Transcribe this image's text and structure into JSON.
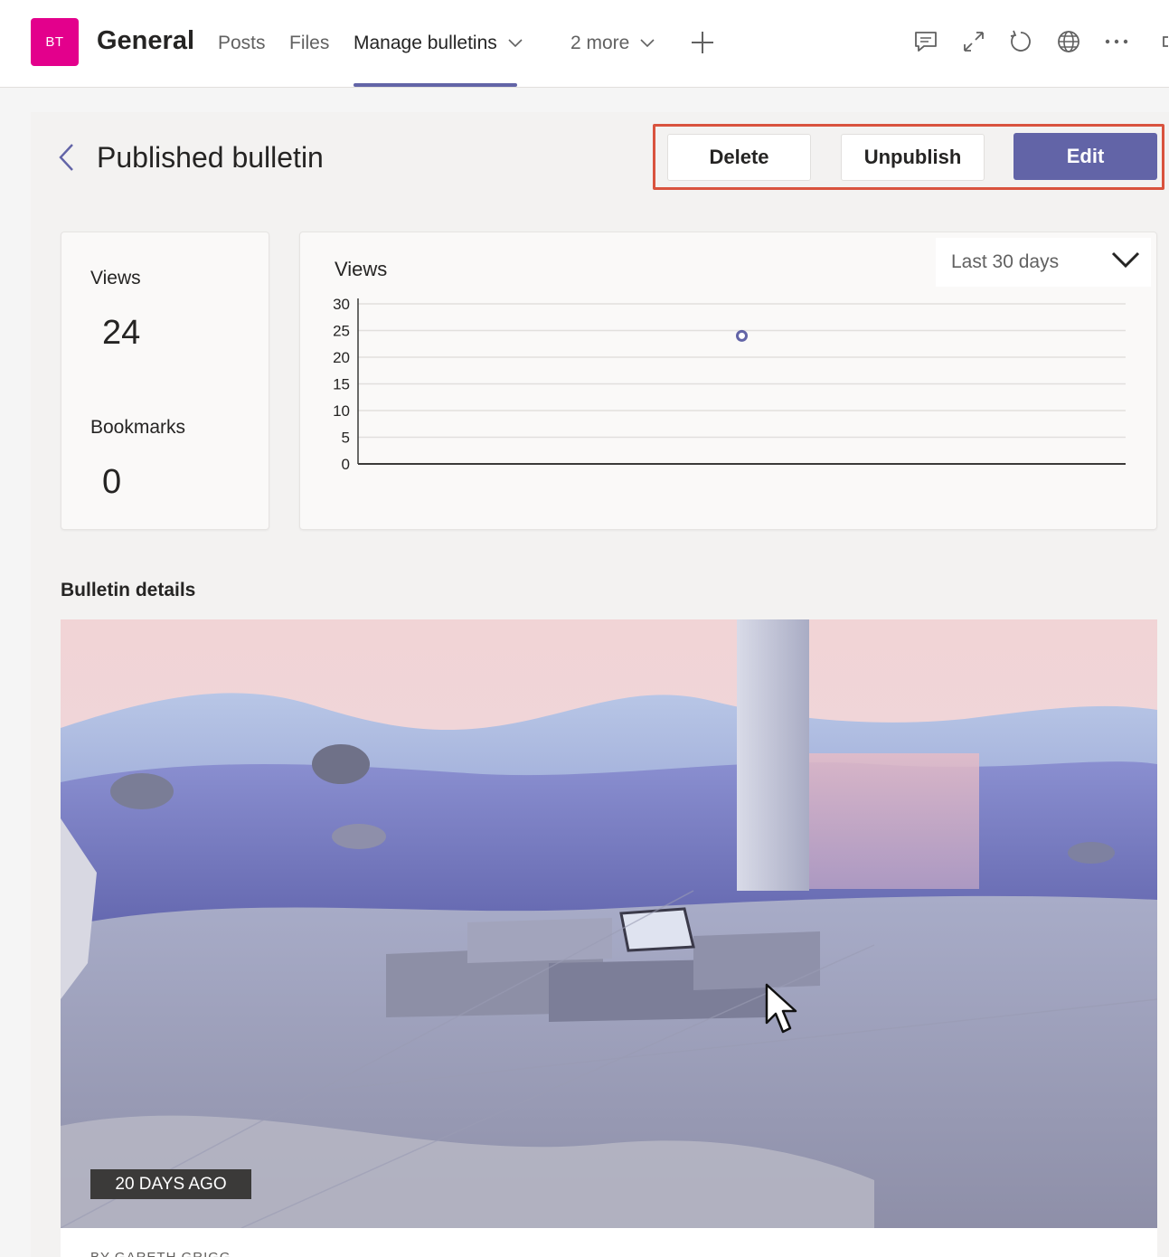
{
  "header": {
    "avatar_initials": "BT",
    "avatar_color": "#e3008c",
    "channel": "General",
    "tabs": [
      {
        "label": "Posts"
      },
      {
        "label": "Files"
      },
      {
        "label": "Manage bulletins"
      },
      {
        "label": "2 more"
      }
    ],
    "active_tab": "Manage bulletins",
    "icons": [
      "plus-icon",
      "chat-icon",
      "expand-icon",
      "refresh-icon",
      "globe-icon",
      "more-icon"
    ]
  },
  "page": {
    "title": "Published bulletin",
    "actions": {
      "delete": "Delete",
      "unpublish": "Unpublish",
      "edit": "Edit"
    },
    "accent_color": "#6264a7",
    "highlight_color": "#d9533e"
  },
  "stats": {
    "views_label": "Views",
    "views_value": "24",
    "bookmarks_label": "Bookmarks",
    "bookmarks_value": "0"
  },
  "chart": {
    "range_selected": "Last 30 days"
  },
  "chart_data": {
    "type": "scatter",
    "title": "Views",
    "xlabel": "",
    "ylabel": "",
    "ylim": [
      0,
      30
    ],
    "yticks": [
      "30",
      "25",
      "20",
      "15",
      "10",
      "5",
      "0"
    ],
    "grid": true,
    "series": [
      {
        "values": [
          {
            "x": 1,
            "y": 24
          }
        ]
      }
    ]
  },
  "details": {
    "section_title": "Bulletin details",
    "badge": "20 DAYS AGO",
    "byline_partial": "BY GARETH GRIGG"
  }
}
